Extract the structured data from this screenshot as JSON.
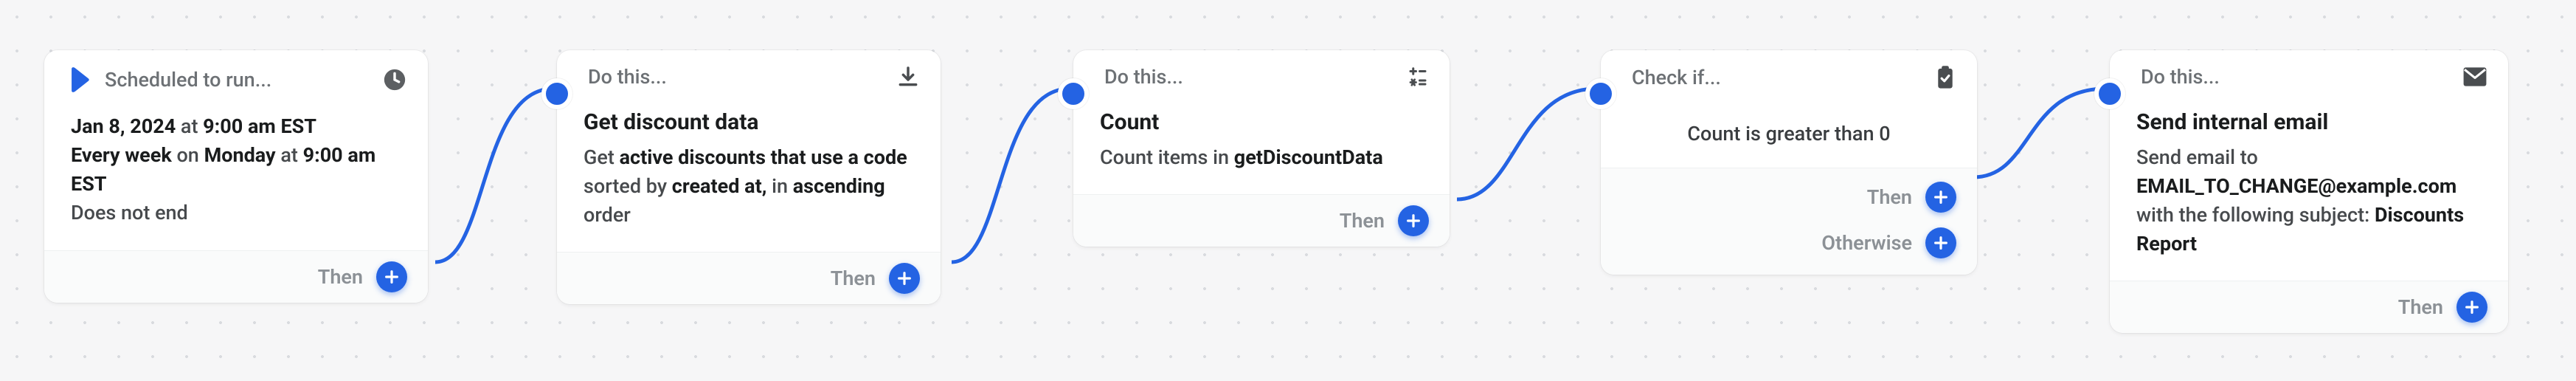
{
  "nodes": {
    "trigger": {
      "head_label": "Scheduled to run...",
      "line1_prefix": "Jan 8, 2024",
      "line1_at": " at ",
      "line1_time": "9:00 am EST",
      "line2_prefix": "Every week",
      "line2_on": " on ",
      "line2_day": "Monday",
      "line2_at": " at ",
      "line2_time": "9:00 am EST",
      "line3": "Does not end",
      "then_label": "Then"
    },
    "step1": {
      "head_label": "Do this...",
      "title": "Get discount data",
      "desc_pre": "Get ",
      "desc_b1": "active discounts that use a code",
      "desc_mid": " sorted by ",
      "desc_b2": "created at,",
      "desc_mid2": " in ",
      "desc_b3": "ascending",
      "desc_post": " order",
      "then_label": "Then"
    },
    "step2": {
      "head_label": "Do this...",
      "title": "Count",
      "desc_pre": "Count items in ",
      "desc_b1": "getDiscountData",
      "then_label": "Then"
    },
    "cond": {
      "head_label": "Check if...",
      "body": "Count is greater than 0",
      "then_label": "Then",
      "otherwise_label": "Otherwise"
    },
    "step3": {
      "head_label": "Do this...",
      "title": "Send internal email",
      "desc_pre": "Send email to ",
      "desc_b1": "EMAIL_TO_CHANGE@example.com",
      "desc_mid": " with the following subject: ",
      "desc_b2": "Discounts Report",
      "then_label": "Then"
    }
  }
}
